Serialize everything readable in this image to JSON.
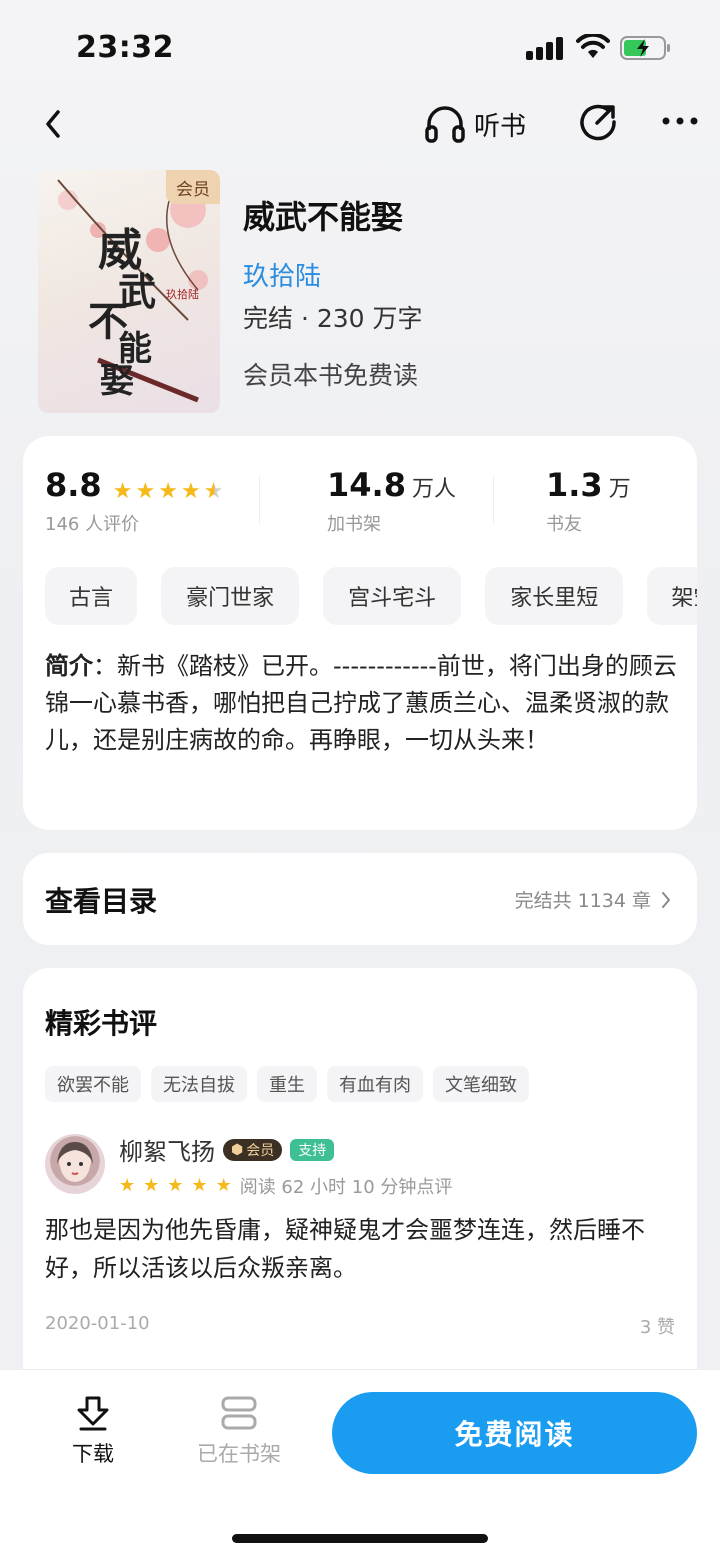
{
  "status": {
    "time": "23:32"
  },
  "nav": {
    "listen_label": "听书"
  },
  "book": {
    "title": "威武不能娶",
    "author": "玖拾陆",
    "meta": "完结 · 230 万字",
    "free_note": "会员本书免费读",
    "cover_badge": "会员",
    "cover_title": "威武不能娶"
  },
  "stats": {
    "rating": "8.8",
    "rating_stars": 4.5,
    "rating_label": "146 人评价",
    "shelf_num": "14.8",
    "shelf_unit": "万人",
    "shelf_label": "加书架",
    "friends_num": "1.3",
    "friends_unit": "万",
    "friends_label": "书友"
  },
  "tags": [
    "古言",
    "豪门世家",
    "宫斗宅斗",
    "家长里短",
    "架空"
  ],
  "intro": {
    "label": "简介",
    "text": "：新书《踏枝》已开。------------前世，将门出身的顾云锦一心慕书香，哪怕把自己拧成了蕙质兰心、温柔贤淑的款儿，还是别庄病故的命。再睁眼，一切从头来！"
  },
  "toc": {
    "title": "查看目录",
    "info": "完结共 1134 章"
  },
  "reviews": {
    "title": "精彩书评",
    "tags": [
      "欲罢不能",
      "无法自拔",
      "重生",
      "有血有肉",
      "文笔细致"
    ],
    "item": {
      "name": "柳絮飞扬",
      "vip_badge": "会员",
      "support_badge": "支持",
      "stars": 5,
      "read_time": "阅读 62 小时 10 分钟点评",
      "text": "那也是因为他先昏庸，疑神疑鬼才会噩梦连连，然后睡不好，所以活该以后众叛亲离。",
      "date": "2020-01-10",
      "likes": "3 赞"
    }
  },
  "bottom": {
    "download_label": "下载",
    "shelf_label": "已在书架",
    "read_label": "免费阅读"
  },
  "colors": {
    "accent": "#1a9cf0",
    "author": "#2a8de0",
    "star": "#f5b91a"
  }
}
